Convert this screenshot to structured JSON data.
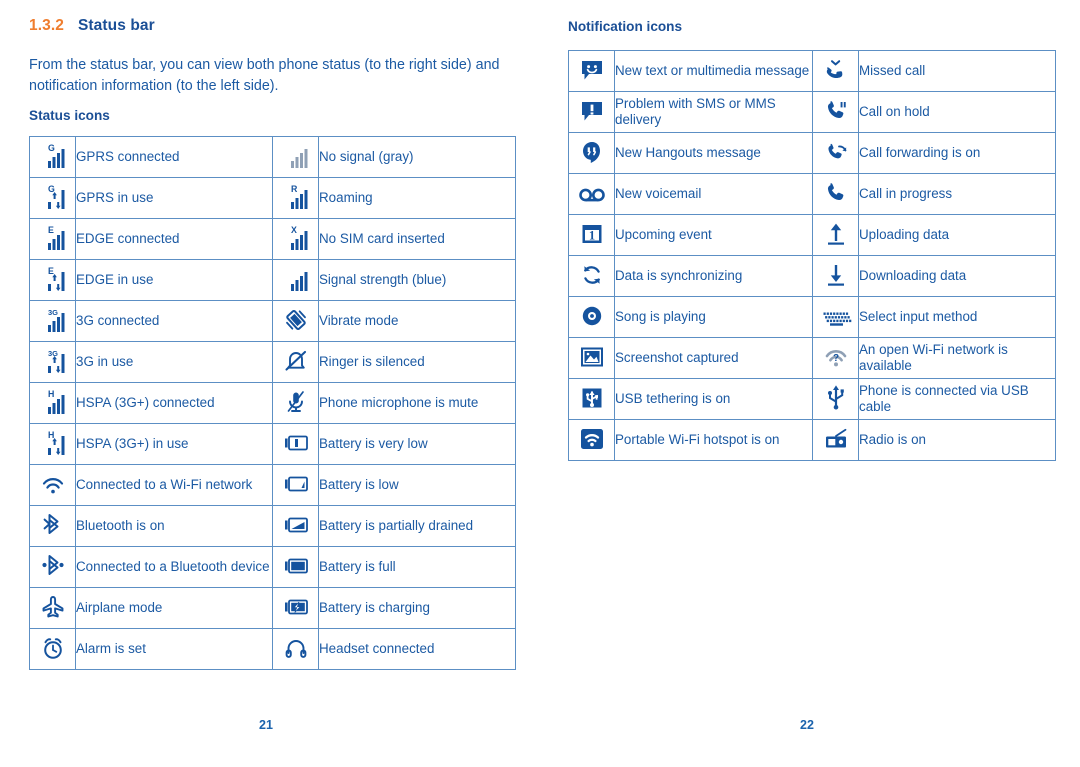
{
  "section": {
    "number": "1.3.2",
    "title": "Status bar",
    "intro": "From the status bar, you can view both phone status (to the right side) and notification information (to the left side)."
  },
  "status_icons": {
    "heading": "Status icons",
    "rows": [
      {
        "left": {
          "icon": "signal-bars-gprs-icon",
          "label": "GPRS connected"
        },
        "right": {
          "icon": "signal-bars-no-signal-icon",
          "label": "No signal (gray)"
        }
      },
      {
        "left": {
          "icon": "signal-bars-gprs-in-use-icon",
          "label": "GPRS in use"
        },
        "right": {
          "icon": "signal-bars-roaming-icon",
          "label": "Roaming"
        }
      },
      {
        "left": {
          "icon": "signal-bars-edge-icon",
          "label": "EDGE connected"
        },
        "right": {
          "icon": "signal-bars-no-sim-icon",
          "label": "No SIM card inserted"
        }
      },
      {
        "left": {
          "icon": "signal-bars-edge-in-use-icon",
          "label": "EDGE in use"
        },
        "right": {
          "icon": "signal-bars-strength-icon",
          "label": "Signal strength (blue)"
        }
      },
      {
        "left": {
          "icon": "signal-bars-3g-icon",
          "label": "3G connected"
        },
        "right": {
          "icon": "vibrate-mode-icon",
          "label": "Vibrate mode"
        }
      },
      {
        "left": {
          "icon": "signal-bars-3g-in-use-icon",
          "label": "3G in use"
        },
        "right": {
          "icon": "ringer-silenced-icon",
          "label": "Ringer is silenced"
        }
      },
      {
        "left": {
          "icon": "signal-bars-hspa-icon",
          "label": "HSPA (3G+) connected"
        },
        "right": {
          "icon": "microphone-mute-icon",
          "label": "Phone microphone is mute"
        }
      },
      {
        "left": {
          "icon": "signal-bars-hspa-in-use-icon",
          "label": "HSPA (3G+) in use"
        },
        "right": {
          "icon": "battery-very-low-icon",
          "label": "Battery is very low"
        }
      },
      {
        "left": {
          "icon": "wifi-connected-icon",
          "label": "Connected to a Wi-Fi network"
        },
        "right": {
          "icon": "battery-low-icon",
          "label": "Battery is low"
        }
      },
      {
        "left": {
          "icon": "bluetooth-on-icon",
          "label": "Bluetooth is on"
        },
        "right": {
          "icon": "battery-partial-icon",
          "label": "Battery is partially drained"
        }
      },
      {
        "left": {
          "icon": "bluetooth-connected-icon",
          "label": "Connected to a Bluetooth device"
        },
        "right": {
          "icon": "battery-full-icon",
          "label": "Battery is full"
        }
      },
      {
        "left": {
          "icon": "airplane-mode-icon",
          "label": "Airplane mode"
        },
        "right": {
          "icon": "battery-charging-icon",
          "label": "Battery is charging"
        }
      },
      {
        "left": {
          "icon": "alarm-clock-icon",
          "label": "Alarm is set"
        },
        "right": {
          "icon": "headset-icon",
          "label": "Headset connected"
        }
      }
    ]
  },
  "notification_icons": {
    "heading": "Notification icons",
    "rows": [
      {
        "left": {
          "icon": "message-smiley-icon",
          "label": "New text or multimedia message"
        },
        "right": {
          "icon": "missed-call-icon",
          "label": "Missed call"
        }
      },
      {
        "left": {
          "icon": "message-problem-icon",
          "label": "Problem with SMS or MMS delivery"
        },
        "right": {
          "icon": "call-on-hold-icon",
          "label": "Call on hold"
        }
      },
      {
        "left": {
          "icon": "hangouts-icon",
          "label": "New Hangouts message"
        },
        "right": {
          "icon": "call-forwarding-icon",
          "label": "Call forwarding is on"
        }
      },
      {
        "left": {
          "icon": "voicemail-icon",
          "label": "New voicemail"
        },
        "right": {
          "icon": "call-in-progress-icon",
          "label": "Call in progress"
        }
      },
      {
        "left": {
          "icon": "calendar-event-icon",
          "label": "Upcoming event"
        },
        "right": {
          "icon": "upload-icon",
          "label": "Uploading data"
        }
      },
      {
        "left": {
          "icon": "sync-icon",
          "label": "Data is synchronizing"
        },
        "right": {
          "icon": "download-icon",
          "label": "Downloading data"
        }
      },
      {
        "left": {
          "icon": "music-disc-icon",
          "label": "Song is playing"
        },
        "right": {
          "icon": "keyboard-icon",
          "label": "Select input method"
        }
      },
      {
        "left": {
          "icon": "screenshot-icon",
          "label": "Screenshot captured"
        },
        "right": {
          "icon": "wifi-open-network-icon",
          "label": "An open Wi-Fi network is available"
        }
      },
      {
        "left": {
          "icon": "usb-tethering-icon",
          "label": "USB tethering is on"
        },
        "right": {
          "icon": "usb-cable-icon",
          "label": "Phone is connected via USB cable"
        }
      },
      {
        "left": {
          "icon": "wifi-hotspot-icon",
          "label": "Portable Wi-Fi hotspot is on"
        },
        "right": {
          "icon": "radio-icon",
          "label": "Radio is on"
        }
      }
    ]
  },
  "footer": {
    "page_left": "21",
    "page_right": "22"
  },
  "colors": {
    "accent_orange": "#ef7d2e",
    "text_blue": "#1c5aa3",
    "heading_blue": "#1b4f96",
    "border_blue": "#5c8fc4",
    "icon_blue": "#15539e",
    "gray": "#8fa0b5"
  }
}
